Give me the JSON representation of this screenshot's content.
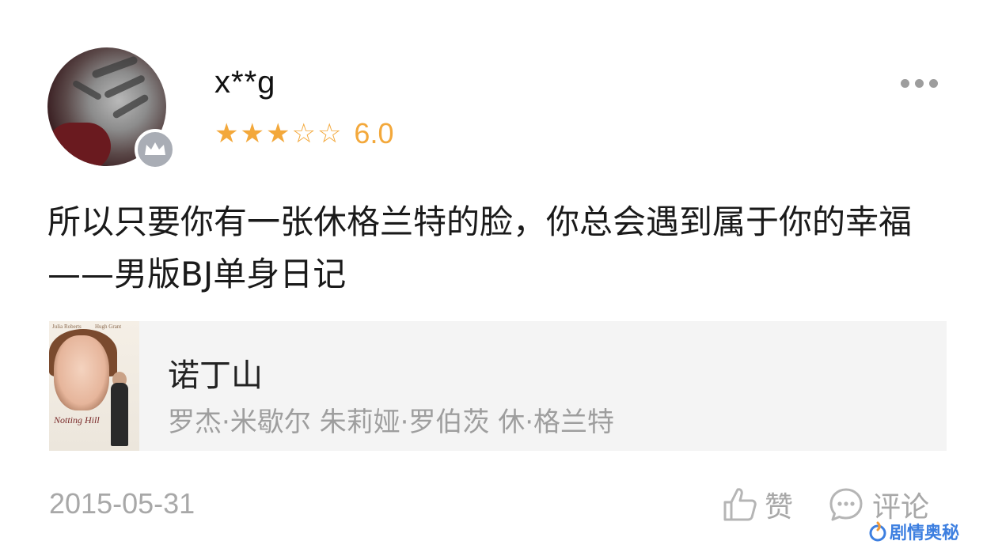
{
  "user": {
    "name": "x**g",
    "rating_stars": 3,
    "rating_max": 5,
    "rating_score": "6.0"
  },
  "review": {
    "text": "所以只要你有一张休格兰特的脸，你总会遇到属于你的幸福——男版BJ单身日记"
  },
  "movie": {
    "title": "诺丁山",
    "cast": "罗杰·米歇尔 朱莉娅·罗伯茨 休·格兰特",
    "poster_text": {
      "actor_left": "Julia Roberts",
      "actor_right": "Hugh Grant",
      "title": "Notting Hill"
    }
  },
  "footer": {
    "date": "2015-05-31",
    "like_label": "赞",
    "comment_label": "评论"
  },
  "watermark": {
    "text": "剧情奥秘"
  },
  "colors": {
    "star": "#f3a83b",
    "muted": "#a8a8a8",
    "card_bg": "#f4f4f4",
    "watermark": "#3d7fe0"
  }
}
